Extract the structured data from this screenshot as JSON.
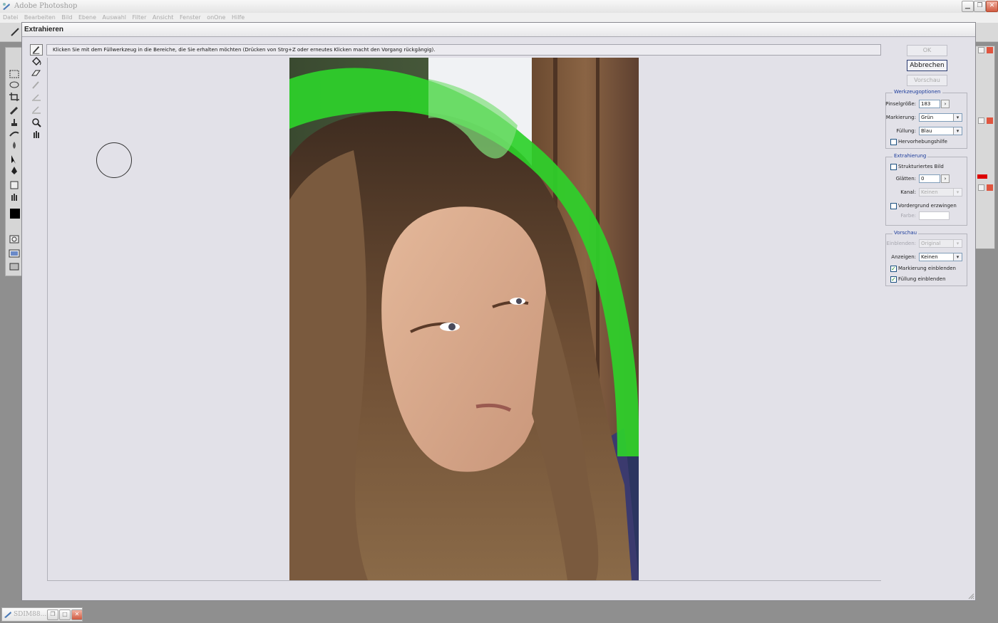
{
  "app": {
    "title": "Adobe Photoshop"
  },
  "menu": [
    "Datei",
    "Bearbeiten",
    "Bild",
    "Ebene",
    "Auswahl",
    "Filter",
    "Ansicht",
    "Fenster",
    "onOne",
    "Hilfe"
  ],
  "dialog": {
    "title": "Extrahieren",
    "instruction": "Klicken Sie mit dem Füllwerkzeug in die Bereiche, die Sie erhalten möchten (Drücken von Strg+Z oder erneutes Klicken macht den Vorgang rückgängig).",
    "buttons": {
      "ok": "OK",
      "cancel": "Abbrechen",
      "preview": "Vorschau"
    },
    "tool_options": {
      "title": "Werkzeugoptionen",
      "brush_size_label": "Pinselgröße:",
      "brush_size": "183",
      "highlight_label": "Markierung:",
      "highlight": "Grün",
      "fill_label": "Füllung:",
      "fill": "Blau",
      "smart_highlight": "Hervorhebungshilfe"
    },
    "extraction": {
      "title": "Extrahierung",
      "textured": "Strukturiertes Bild",
      "smooth_label": "Glätten:",
      "smooth": "0",
      "channel_label": "Kanal:",
      "channel": "Keinen",
      "force_fg": "Vordergrund erzwingen",
      "color_label": "Farbe:"
    },
    "preview_group": {
      "title": "Vorschau",
      "show_label": "Einblenden:",
      "show": "Original",
      "display_label": "Anzeigen:",
      "display": "Keinen",
      "show_highlight": "Markierung einblenden",
      "show_fill": "Füllung einblenden"
    }
  },
  "taskbar": {
    "doc": "SDIM88..."
  },
  "colors": {
    "highlight_green": "#2ed12a",
    "group_title": "#1a3a9a",
    "foreground": "#000000"
  }
}
